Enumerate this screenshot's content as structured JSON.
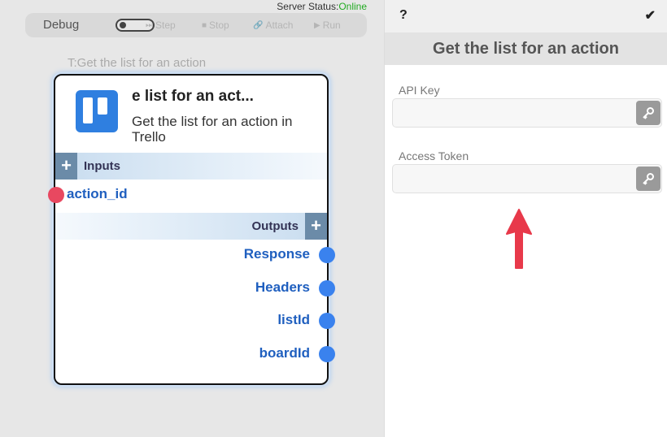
{
  "server_status": {
    "label": "Server Status:",
    "value": "Online"
  },
  "debug_bar": {
    "label": "Debug",
    "toggle_on": false,
    "buttons": [
      {
        "icon": "step-icon",
        "label": "Step"
      },
      {
        "icon": "stop-icon",
        "label": "Stop"
      },
      {
        "icon": "attach-icon",
        "label": "Attach"
      },
      {
        "icon": "run-icon",
        "label": "Run"
      }
    ]
  },
  "node": {
    "canvas_label": "T:Get the list for an action",
    "title": "e list for an act...",
    "description": "Get the list for an action in Trello",
    "logo": "trello-logo",
    "inputs_label": "Inputs",
    "inputs": [
      "action_id"
    ],
    "outputs_label": "Outputs",
    "outputs": [
      "Response",
      "Headers",
      "listId",
      "boardId"
    ]
  },
  "panel": {
    "help_label": "?",
    "confirm_icon": "checkmark-icon",
    "title": "Get the list for an action",
    "fields": [
      {
        "label": "API Key",
        "value": "",
        "placeholder": ""
      },
      {
        "label": "Access Token",
        "value": "",
        "placeholder": ""
      }
    ]
  },
  "colors": {
    "online": "#22aa22",
    "input_port": "#e84860",
    "output_port": "#3a82ee",
    "port_label": "#1f5fbf",
    "annotation_arrow": "#e8394a"
  }
}
